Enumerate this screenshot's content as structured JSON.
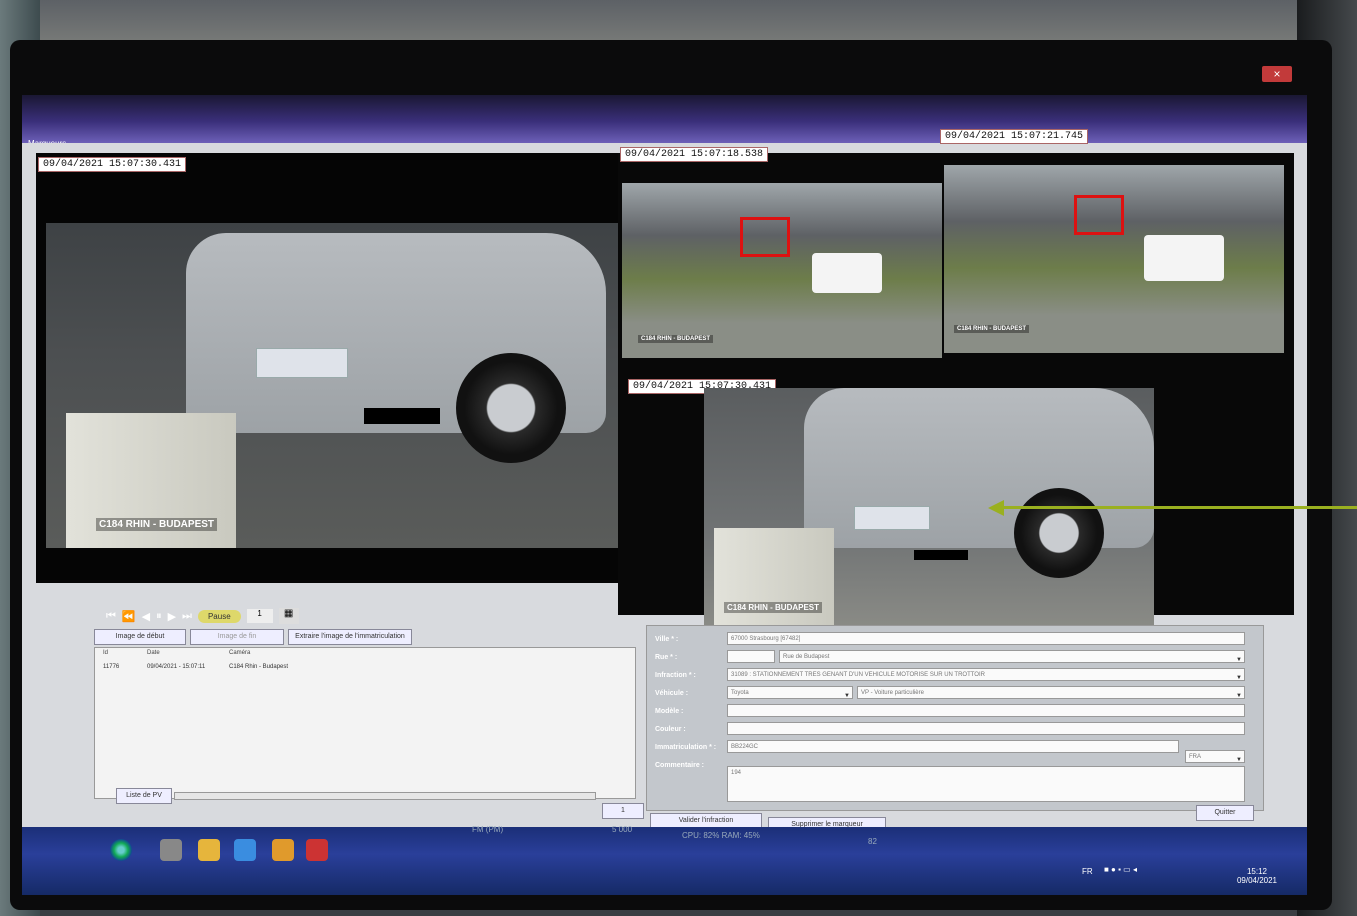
{
  "window": {
    "title": "Marqueurs",
    "close": "×"
  },
  "main_video": {
    "timestamp": "09/04/2021 15:07:30.431",
    "location": "C184 RHIN - BUDAPEST",
    "controls": {
      "pause_label": "Pause"
    }
  },
  "thumbnails": [
    {
      "timestamp": "09/04/2021 15:07:18.538",
      "location": "C184 RHIN - BUDAPEST"
    },
    {
      "timestamp": "09/04/2021 15:07:21.745",
      "location": "C184 RHIN - BUDAPEST"
    }
  ],
  "zoom_video": {
    "timestamp": "09/04/2021 15:07:30.431",
    "location": "C184 RHIN - BUDAPEST"
  },
  "buttons": {
    "start_image": "Image de début",
    "end_image": "Image de fin",
    "extract_plate": "Extraire l'image de l'immatriculation",
    "pv_list": "Liste de PV",
    "validate": "Valider l'infraction",
    "delete_marker": "Supprimer le marqueur",
    "quit": "Quitter"
  },
  "list": {
    "headers": [
      "Id",
      "Date",
      "Caméra"
    ],
    "rows": [
      [
        "11776",
        "09/04/2021 - 15:07:11",
        "C184 Rhin - Budapest"
      ]
    ],
    "counter": "1"
  },
  "form": {
    "labels": {
      "ville": "Ville * :",
      "rue": "Rue * :",
      "infraction": "Infraction * :",
      "vehicule": "Véhicule :",
      "modele": "Modèle :",
      "couleur": "Couleur :",
      "immatriculation": "Immatriculation * :",
      "commentaire": "Commentaire :"
    },
    "values": {
      "ville": "67000 Strasbourg [67482]",
      "rue": "Rue de Budapest",
      "infraction": "31089 : STATIONNEMENT TRES GENANT D'UN VEHICULE MOTORISE SUR UN TROTTOIR",
      "marque": "Toyota",
      "type": "VP - Voiture particulière",
      "modele": "",
      "couleur": "",
      "immatriculation": "BB224GC",
      "pays": "FRA",
      "commentaire": "194"
    }
  },
  "taskbar": {
    "items": [
      "FM (PM)",
      "5 000",
      "CPU: 82% RAM: 45%",
      "82"
    ],
    "language": "FR",
    "time": "15:12",
    "date": "09/04/2021"
  }
}
